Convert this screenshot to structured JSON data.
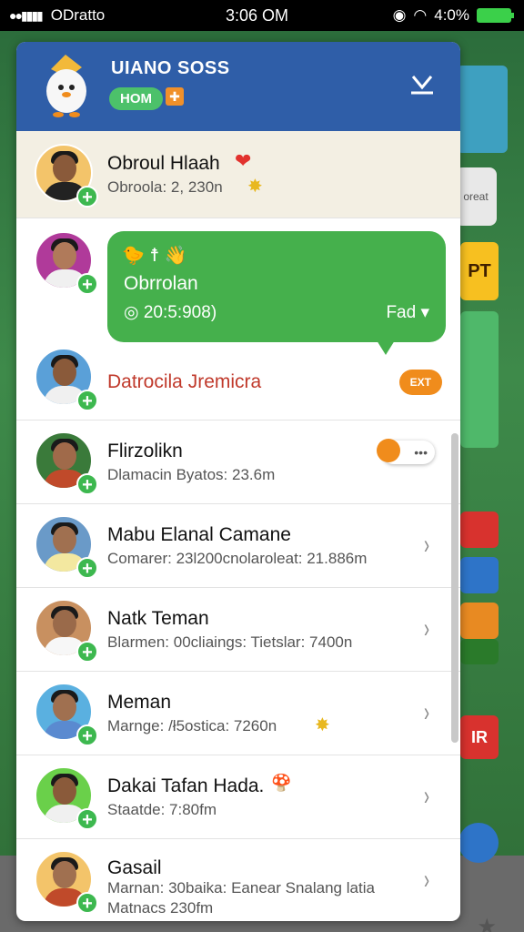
{
  "status_bar": {
    "carrier": "ODratto",
    "time": "3:06 OM",
    "battery": "4:0%"
  },
  "background": {
    "orcat_label": "oreat",
    "pt_label": "PT",
    "r_label": "IR"
  },
  "header": {
    "title": "UIANO SOSS",
    "badge": "HOM",
    "gift_glyph": "✚"
  },
  "rows": [
    {
      "name": "Obroul Hlaah",
      "sub": "Obroola: 2, 230n",
      "emoji": "❤",
      "sub_emoji": "✸",
      "highlight": true
    },
    {
      "bubble": true,
      "icons": "🐤 ☨ 👋",
      "name": "Obrrolan",
      "sub": "◎ 20:5:908)",
      "button": "Fad ▾"
    },
    {
      "name": "Datrocila Jremicra",
      "exit": "EXT",
      "name_color": "#c0392b"
    },
    {
      "name": "Flirzolikn",
      "sub": "Dlamacin  Byatos: 23.6m",
      "chat": "•••"
    },
    {
      "name": "Mabu Elanal Camane",
      "sub": "Comarer: 23l200cnolaroleat: 21.886m",
      "chevron": "›"
    },
    {
      "name": "Natk Teman",
      "sub": "Blarmen:  00cliaings: Tietslar: 7400n",
      "chevron": "›"
    },
    {
      "name": "Meman",
      "sub": "Marnge: /ł5ostica: 7260n",
      "sub_emoji": "✸",
      "chevron": "›"
    },
    {
      "name": "Dakai Tafan Hada.",
      "sub": "Staatde: 7:80fm",
      "emoji": "🍄",
      "chevron": "›"
    },
    {
      "name": "Gasail",
      "sub": "Marnan: 30baika: Eanear Snalang latia",
      "sub2": "Matnacs 230fm",
      "chevron": "›"
    }
  ],
  "plus_glyph": "+",
  "colors": {
    "header_bg": "#2f5ea8",
    "accent_green": "#45b04c",
    "exit_orange": "#f08c1c"
  }
}
